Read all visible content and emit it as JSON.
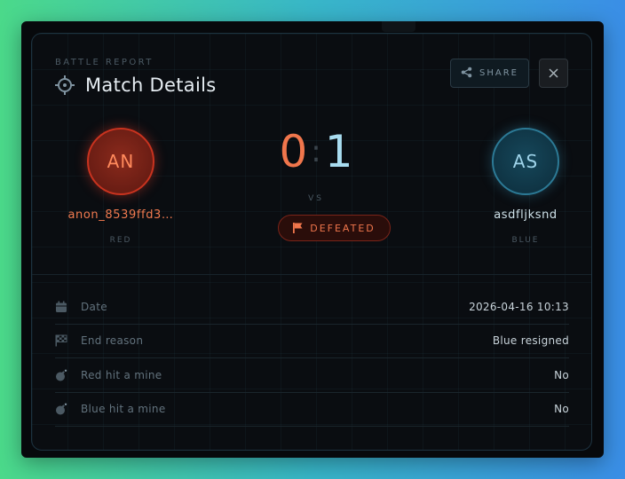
{
  "header": {
    "eyebrow": "BATTLE REPORT",
    "title": "Match Details",
    "share_label": "SHARE",
    "close_label": "×"
  },
  "players": {
    "red": {
      "initials": "AN",
      "name": "anon_8539ffd3…",
      "side": "RED"
    },
    "blue": {
      "initials": "AS",
      "name": "asdfljksnd",
      "side": "BLUE"
    }
  },
  "score": {
    "red": "0",
    "separator": ":",
    "blue": "1",
    "vs": "VS",
    "result": "DEFEATED"
  },
  "details": [
    {
      "icon": "calendar-icon",
      "label": "Date",
      "value": "2026-04-16 10:13"
    },
    {
      "icon": "checkered-flag-icon",
      "label": "End reason",
      "value": "Blue resigned"
    },
    {
      "icon": "bomb-icon",
      "label": "Red hit a mine",
      "value": "No"
    },
    {
      "icon": "bomb-icon",
      "label": "Blue hit a mine",
      "value": "No"
    }
  ],
  "colors": {
    "red_accent": "#f0764c",
    "blue_accent": "#a8dcf0",
    "background": "#07090c"
  }
}
